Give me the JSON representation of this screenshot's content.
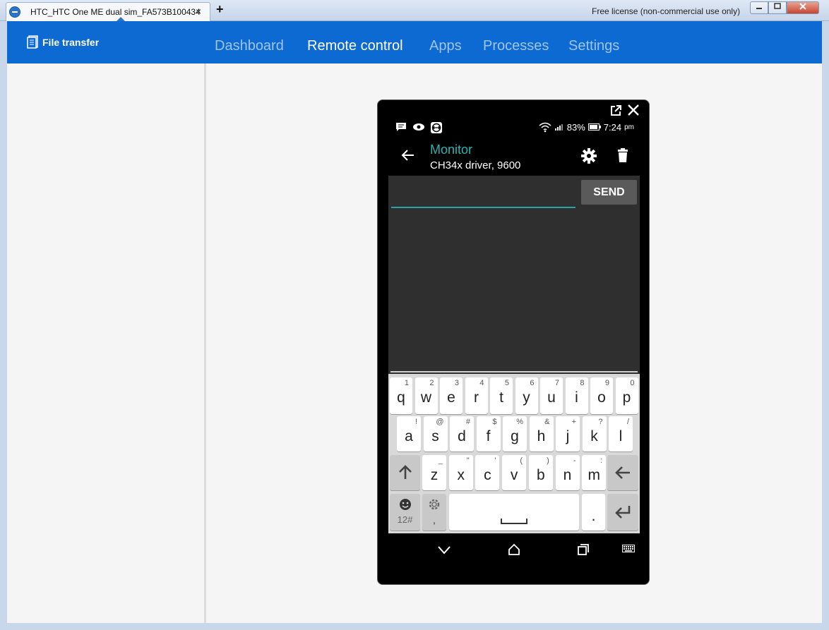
{
  "window": {
    "tab_title": "HTC_HTC One ME dual sim_FA573B100434",
    "tab_close": "×",
    "new_tab": "+",
    "license": "Free license (non-commercial use only)"
  },
  "header": {
    "file_transfer": "File transfer",
    "nav": [
      "Dashboard",
      "Remote control",
      "Apps",
      "Processes",
      "Settings"
    ],
    "active": "Remote control"
  },
  "phone": {
    "status": {
      "battery": "83%",
      "time": "7:24",
      "ampm": "pm"
    },
    "actionbar": {
      "title": "Monitor",
      "subtitle": "CH34x driver, 9600"
    },
    "send_label": "SEND",
    "input_value": "",
    "keyboard": {
      "row1": [
        [
          "q",
          "1"
        ],
        [
          "w",
          "2"
        ],
        [
          "e",
          "3"
        ],
        [
          "r",
          "4"
        ],
        [
          "t",
          "5"
        ],
        [
          "y",
          "6"
        ],
        [
          "u",
          "7"
        ],
        [
          "i",
          "8"
        ],
        [
          "o",
          "9"
        ],
        [
          "p",
          "0"
        ]
      ],
      "row2": [
        [
          "a",
          "!"
        ],
        [
          "s",
          "@"
        ],
        [
          "d",
          "#"
        ],
        [
          "f",
          "$"
        ],
        [
          "g",
          "%"
        ],
        [
          "h",
          "&"
        ],
        [
          "j",
          "+"
        ],
        [
          "k",
          "?"
        ],
        [
          "l",
          "/"
        ]
      ],
      "row3": [
        [
          "z",
          "_"
        ],
        [
          "x",
          "\""
        ],
        [
          "c",
          "'"
        ],
        [
          "v",
          "("
        ],
        [
          "b",
          ")"
        ],
        [
          "n",
          "-"
        ],
        [
          "m",
          ":"
        ]
      ],
      "symbols_label": "12#",
      "comma": ",",
      "period": "."
    }
  },
  "colors": {
    "brand_blue": "#0e6ad3",
    "teal_accent": "#2bb3b3"
  }
}
